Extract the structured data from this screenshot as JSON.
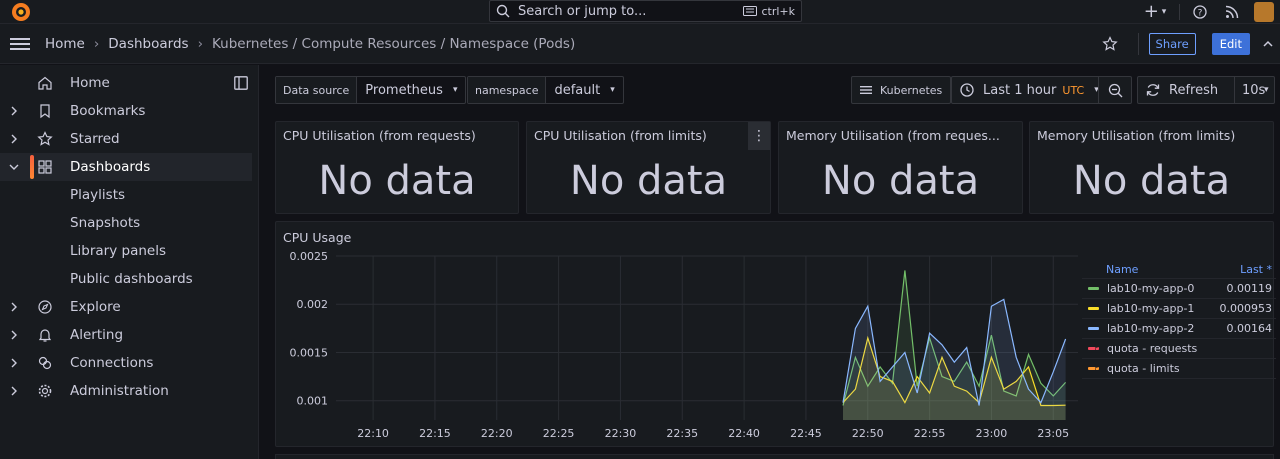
{
  "topbar": {
    "search_placeholder": "Search or jump to...",
    "search_shortcut": "ctrl+k"
  },
  "breadcrumbs": [
    "Home",
    "Dashboards",
    "Kubernetes / Compute Resources / Namespace (Pods)"
  ],
  "nav_actions": {
    "share": "Share",
    "edit": "Edit"
  },
  "sidebar": {
    "items": [
      {
        "label": "Home",
        "icon": "home-icon"
      },
      {
        "label": "Bookmarks",
        "icon": "bookmark-icon"
      },
      {
        "label": "Starred",
        "icon": "star-icon"
      },
      {
        "label": "Dashboards",
        "icon": "apps-icon"
      },
      {
        "label": "Playlists"
      },
      {
        "label": "Snapshots"
      },
      {
        "label": "Library panels"
      },
      {
        "label": "Public dashboards"
      },
      {
        "label": "Explore",
        "icon": "compass-icon"
      },
      {
        "label": "Alerting",
        "icon": "bell-icon"
      },
      {
        "label": "Connections",
        "icon": "link-icon"
      },
      {
        "label": "Administration",
        "icon": "cog-icon"
      }
    ]
  },
  "controls": {
    "datasource_label": "Data source",
    "datasource_value": "Prometheus",
    "namespace_label": "namespace",
    "namespace_value": "default",
    "kubernetes_btn": "Kubernetes",
    "time_range": "Last 1 hour",
    "timezone": "UTC",
    "refresh": "Refresh",
    "refresh_interval": "10s"
  },
  "stat_panels": [
    {
      "title": "CPU Utilisation (from requests)",
      "value": "No data"
    },
    {
      "title": "CPU Utilisation (from limits)",
      "value": "No data"
    },
    {
      "title": "Memory Utilisation (from reques...",
      "value": "No data"
    },
    {
      "title": "Memory Utilisation (from limits)",
      "value": "No data"
    }
  ],
  "cpu_panel": {
    "title": "CPU Usage",
    "legend_header_name": "Name",
    "legend_header_last": "Last *",
    "legend": [
      {
        "name": "lab10-my-app-0",
        "last": "0.00119",
        "color": "#73bf69",
        "dashed": false
      },
      {
        "name": "lab10-my-app-1",
        "last": "0.000953",
        "color": "#fade2a",
        "dashed": false
      },
      {
        "name": "lab10-my-app-2",
        "last": "0.00164",
        "color": "#8ab8ff",
        "dashed": false
      },
      {
        "name": "quota - requests",
        "last": "",
        "color": "#f2495c",
        "dashed": true
      },
      {
        "name": "quota - limits",
        "last": "",
        "color": "#ff9830",
        "dashed": true
      }
    ]
  },
  "chart_data": {
    "type": "line",
    "title": "CPU Usage",
    "xlabel": "",
    "ylabel": "",
    "x_ticks": [
      "22:10",
      "22:15",
      "22:20",
      "22:25",
      "22:30",
      "22:35",
      "22:40",
      "22:45",
      "22:50",
      "22:55",
      "23:00",
      "23:05"
    ],
    "y_ticks": [
      "0.0025",
      "0.002",
      "0.0015",
      "0.001"
    ],
    "ylim": [
      0.0008,
      0.0025
    ],
    "xlim": [
      "22:07",
      "23:07"
    ],
    "x": [
      "22:48",
      "22:49",
      "22:50",
      "22:51",
      "22:52",
      "22:53",
      "22:54",
      "22:55",
      "22:56",
      "22:57",
      "22:58",
      "22:59",
      "23:00",
      "23:01",
      "23:02",
      "23:03",
      "23:04",
      "23:05",
      "23:06"
    ],
    "series": [
      {
        "name": "lab10-my-app-0",
        "color": "#73bf69",
        "values": [
          0.00095,
          0.00145,
          0.00115,
          0.00135,
          0.00118,
          0.00235,
          0.00115,
          0.00165,
          0.00125,
          0.0012,
          0.0014,
          0.00115,
          0.00168,
          0.0011,
          0.00105,
          0.00148,
          0.00118,
          0.00105,
          0.00119
        ]
      },
      {
        "name": "lab10-my-app-1",
        "color": "#fade2a",
        "values": [
          0.00098,
          0.00112,
          0.00165,
          0.00125,
          0.0012,
          0.00098,
          0.00125,
          0.00108,
          0.00145,
          0.00115,
          0.0011,
          0.00098,
          0.00145,
          0.00112,
          0.0012,
          0.00135,
          0.00095,
          0.00095,
          0.000953
        ]
      },
      {
        "name": "lab10-my-app-2",
        "color": "#8ab8ff",
        "values": [
          0.00098,
          0.00175,
          0.00198,
          0.0012,
          0.00135,
          0.0015,
          0.00108,
          0.0017,
          0.00158,
          0.0014,
          0.00155,
          0.00095,
          0.00198,
          0.00205,
          0.00145,
          0.00112,
          0.00098,
          0.0013,
          0.00164
        ]
      }
    ],
    "legend_position": "right",
    "grid": true
  }
}
